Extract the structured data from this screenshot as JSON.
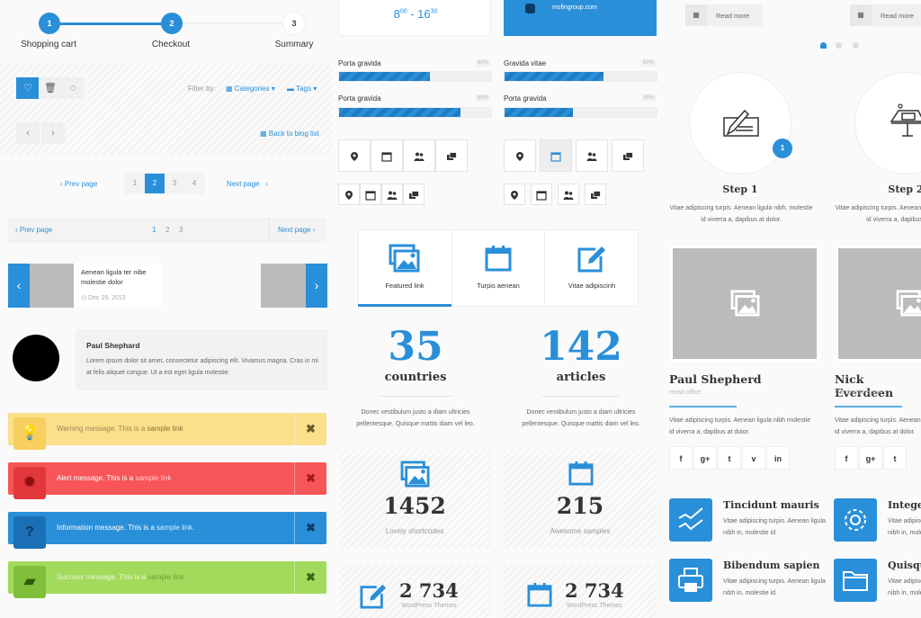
{
  "steps": [
    {
      "num": "1",
      "label": "Shopping cart",
      "done": true
    },
    {
      "num": "2",
      "label": "Checkout",
      "done": true
    },
    {
      "num": "3",
      "label": "Summary",
      "done": false
    }
  ],
  "filter": {
    "toggle_icons": [
      "heart-icon",
      "trash-icon",
      "comment-icon"
    ],
    "label": "Filter by:",
    "categories": "Categories",
    "tags": "Tags",
    "caret": "▾"
  },
  "nav": {
    "prev_arrow": "‹",
    "next_arrow": "›",
    "back_to_blog": "Back to blog list"
  },
  "pagination1": {
    "prev": "Prev page",
    "next": "Next page",
    "pages": [
      "1",
      "2",
      "3",
      "4"
    ],
    "active": "2"
  },
  "pagination2": {
    "prev": "Prev page",
    "next": "Next page",
    "pages": [
      "1",
      "2",
      "3"
    ]
  },
  "post_slider": {
    "title": "Aenean ligula ter nibe molestie dolor",
    "date": "Dec 29, 2013",
    "prev": "‹",
    "next": "›"
  },
  "testimonial": {
    "name": "Paul Shephard",
    "text": "Lorem ipsum dolor sit amet, consectetur adipiscing elit. Vivamus magna. Cras in mi at felis aliquet congue. Ut a est eget ligula molestie."
  },
  "alerts": [
    {
      "type": "warning",
      "text": "Warning message. This is a ",
      "link": "sample link",
      "icon": "lightbulb-icon",
      "close": "✖"
    },
    {
      "type": "alert",
      "text": "Alert message. This is a ",
      "link": "sample link",
      "icon": "gear-burst-icon",
      "close": "✖"
    },
    {
      "type": "info",
      "text": "Information message. This is a ",
      "link": "sample link.",
      "icon": "question-icon",
      "close": "✖"
    },
    {
      "type": "success",
      "text": "Success message. This is a ",
      "link": "sample link",
      "icon": "folder-icon",
      "close": "✖"
    }
  ],
  "contact": {
    "hours": "8",
    "hours_sup": "00",
    "hours_end": " - 16",
    "hours_end_sup": "30",
    "email": "msfingroup.com"
  },
  "progress": [
    {
      "label": "Porta gravida",
      "percent": 60
    },
    {
      "label": "Gravida vitae",
      "percent": 65
    },
    {
      "label": "Porta gravida",
      "percent": 80
    },
    {
      "label": "Porta gravida",
      "percent": 45
    }
  ],
  "icon_buttons": [
    "map-marker-icon",
    "calendar-icon",
    "users-icon",
    "chat-icon"
  ],
  "featured_tabs": [
    {
      "label": "Featured link",
      "icon": "images-icon",
      "active": true
    },
    {
      "label": "Turpis aenean",
      "icon": "calendar-icon",
      "active": false
    },
    {
      "label": "Vitae adipiscinh",
      "icon": "edit-icon",
      "active": false
    }
  ],
  "counters": [
    {
      "value": "35",
      "label": "countries",
      "desc": "Donec vestibulum justo a diam ultricies pellentesque. Quisque mattis diam vel leo."
    },
    {
      "value": "142",
      "label": "articles",
      "desc": "Donec vestibulum justo a diam ultricies pellentesque. Quisque mattis diam vel leo."
    }
  ],
  "stat_boxes": [
    {
      "value": "1452",
      "label": "Lovely shortcodes",
      "icon": "images-icon"
    },
    {
      "value": "215",
      "label": "Awesome samples",
      "icon": "calendar-icon"
    },
    {
      "value": "2 734",
      "label": "WordPress Themes",
      "icon": "edit-icon"
    },
    {
      "value": "2 734",
      "label": "WordPress Themes",
      "icon": "calendar-icon"
    }
  ],
  "read_more": [
    "Read more",
    "Read more"
  ],
  "process": [
    {
      "title": "Step 1",
      "badge": "1",
      "desc": "Vitae adipiscing turpis. Aenean ligula nibh, molestie id viverra a, dapibus at dolor."
    },
    {
      "title": "Step 2",
      "desc": "Vitae adipiscing turpis. Aenean ligula nibh, molestie id viverra a, dapibus at dolor."
    }
  ],
  "team": [
    {
      "name": "Paul Shepherd",
      "role": "Head office",
      "desc": "Vitae adipiscing turpis. Aenean ligula nibh molestie id viverra a, dapibus at dolor.",
      "social": [
        "f",
        "g+",
        "t",
        "v",
        "in"
      ]
    },
    {
      "name": "Nick Everdeen",
      "role": "General Director",
      "desc": "Vitae adipiscing turpis. Aenean ligula nibh molestie id viverra a, dapibus at dolor.",
      "social": [
        "f",
        "g+",
        "t"
      ]
    }
  ],
  "features": [
    {
      "title": "Tincidunt mauris",
      "desc": "Vitae adipiscing turpis. Aenean ligula nibh in, molestie id.",
      "icon": "chart-line-icon"
    },
    {
      "title": "Integer",
      "desc": "Vitae adipiscing turpis. Aenean ligula nibh in, molestie id.",
      "icon": "gear-icon"
    },
    {
      "title": "Bibendum sapien",
      "desc": "Vitae adipiscing turpis. Aenean ligula nibh in, molestie id.",
      "icon": "printer-icon"
    },
    {
      "title": "Quisque",
      "desc": "Vitae adipiscing turpis. Aenean ligula nibh in, molestie id.",
      "icon": "folder-icon"
    }
  ],
  "colors": {
    "accent": "#2a8fd9",
    "warning": "#fbdf8a",
    "alert": "#f75558",
    "info": "#2a8fd9",
    "success": "#a2da5b"
  }
}
